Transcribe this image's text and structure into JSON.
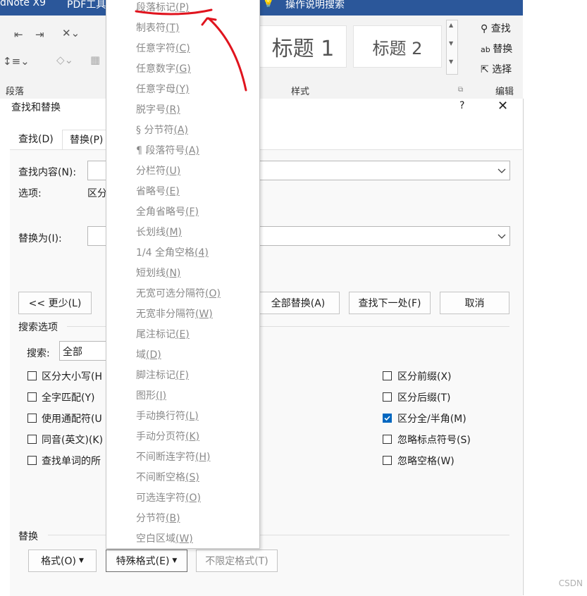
{
  "ribbon": {
    "app_titles": [
      "dNote X9",
      "PDF工具",
      "操作说明搜索"
    ],
    "style_heading1": "标题 1",
    "style_heading2": "标题 2",
    "group_paragraph": "段落",
    "group_styles": "样式",
    "group_editing": "编辑",
    "find": "查找",
    "replace": "替换",
    "select": "选择"
  },
  "dialog": {
    "title": "查找和替换",
    "help": "?",
    "close": "✕",
    "tabs": [
      "查找(D)",
      "替换(P)"
    ],
    "find_label": "查找内容(N):",
    "options_label": "选项:",
    "options_value": "区分",
    "replace_label": "替换为(I):",
    "less_button": "<< 更少(L)",
    "replace_all_button": "全部替换(A)",
    "find_next_button": "查找下一处(F)",
    "cancel_button": "取消",
    "search_options_title": "搜索选项",
    "search_label": "搜索:",
    "search_value": "全部",
    "left_checks": [
      {
        "label": "区分大小写(H",
        "checked": false
      },
      {
        "label": "全字匹配(Y)",
        "checked": false
      },
      {
        "label": "使用通配符(U",
        "checked": false
      },
      {
        "label": "同音(英文)(K)",
        "checked": false
      },
      {
        "label": "查找单词的所",
        "checked": false
      }
    ],
    "right_checks": [
      {
        "label": "区分前缀(X)",
        "checked": false
      },
      {
        "label": "区分后缀(T)",
        "checked": false
      },
      {
        "label": "区分全/半角(M)",
        "checked": true
      },
      {
        "label": "忽略标点符号(S)",
        "checked": false
      },
      {
        "label": "忽略空格(W)",
        "checked": false
      }
    ],
    "replace_section_title": "替换",
    "format_button": "格式(O)",
    "special_button": "特殊格式(E)",
    "no_format_button": "不限定格式(T)"
  },
  "menu": {
    "items": [
      "段落标记(P)",
      "制表符(T)",
      "任意字符(C)",
      "任意数字(G)",
      "任意字母(Y)",
      "脱字号(R)",
      "§ 分节符(A)",
      "¶ 段落符号(A)",
      "分栏符(U)",
      "省略号(E)",
      "全角省略号(F)",
      "长划线(M)",
      "1/4 全角空格(4)",
      "短划线(N)",
      "无宽可选分隔符(O)",
      "无宽非分隔符(W)",
      "尾注标记(E)",
      "域(D)",
      "脚注标记(F)",
      "图形(I)",
      "手动换行符(L)",
      "手动分页符(K)",
      "不间断连字符(H)",
      "不间断空格(S)",
      "可选连字符(O)",
      "分节符(B)",
      "空白区域(W)"
    ]
  },
  "annotation_color": "#e0141e",
  "watermark": "CSDN"
}
